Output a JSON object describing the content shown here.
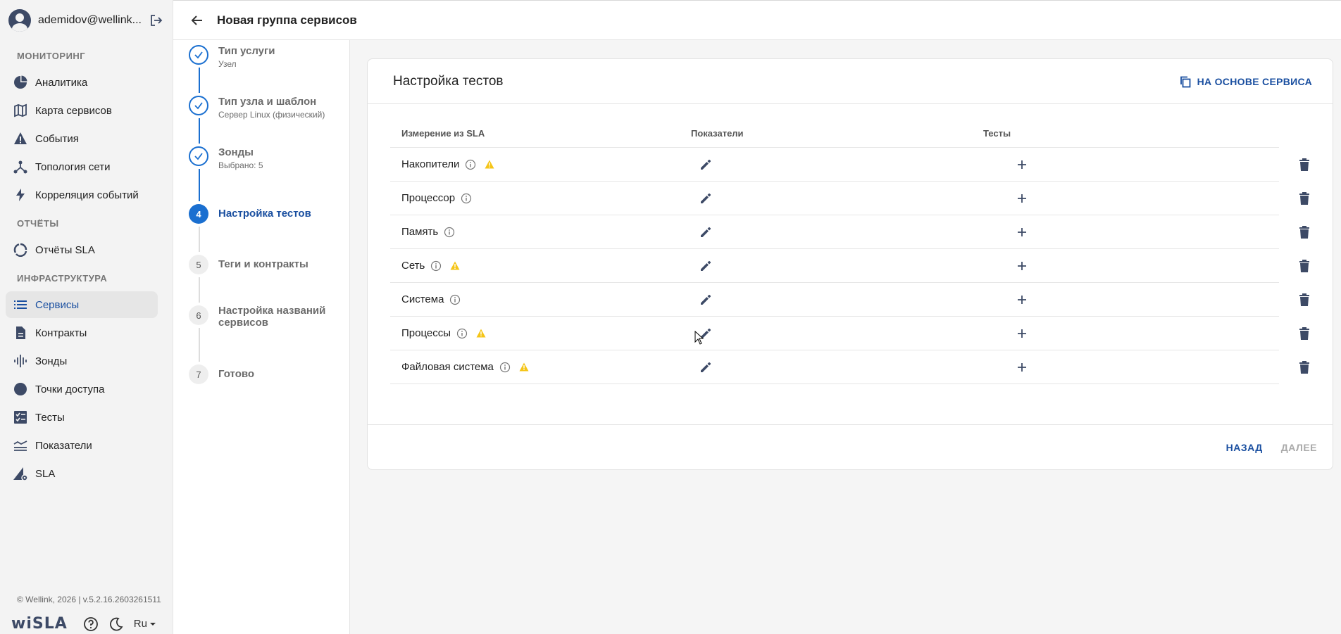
{
  "user": {
    "name": "ademidov@wellink..."
  },
  "sidebar": {
    "sections": [
      {
        "label": "МОНИТОРИНГ",
        "items": [
          {
            "label": "Аналитика",
            "icon": "pie-chart-icon"
          },
          {
            "label": "Карта сервисов",
            "icon": "map-icon"
          },
          {
            "label": "События",
            "icon": "warning-icon"
          },
          {
            "label": "Топология сети",
            "icon": "topology-icon"
          },
          {
            "label": "Корреляция событий",
            "icon": "lightning-icon"
          }
        ]
      },
      {
        "label": "ОТЧЁТЫ",
        "items": [
          {
            "label": "Отчёты SLA",
            "icon": "circle-arrows-icon"
          }
        ]
      },
      {
        "label": "ИНФРАСТРУКТУРА",
        "items": [
          {
            "label": "Сервисы",
            "icon": "list-icon",
            "active": true
          },
          {
            "label": "Контракты",
            "icon": "document-icon"
          },
          {
            "label": "Зонды",
            "icon": "probe-icon"
          },
          {
            "label": "Точки доступа",
            "icon": "dot-icon"
          },
          {
            "label": "Тесты",
            "icon": "checklist-icon"
          },
          {
            "label": "Показатели",
            "icon": "metrics-icon"
          },
          {
            "label": "SLA",
            "icon": "sla-icon"
          }
        ]
      }
    ],
    "footer": {
      "copyright": "© Wellink, 2026 | v.5.2.16.2603261511",
      "brand": "wiSLA",
      "lang": "Ru"
    }
  },
  "header": {
    "title": "Новая группа сервисов"
  },
  "steps": [
    {
      "num": "1",
      "title": "Тип услуги",
      "sub": "Узел",
      "state": "done"
    },
    {
      "num": "2",
      "title": "Тип узла и шаблон",
      "sub": "Сервер Linux (физический)",
      "state": "done"
    },
    {
      "num": "3",
      "title": "Зонды",
      "sub": "Выбрано: 5",
      "state": "done"
    },
    {
      "num": "4",
      "title": "Настройка тестов",
      "sub": "",
      "state": "current"
    },
    {
      "num": "5",
      "title": "Теги и контракты",
      "sub": "",
      "state": "todo"
    },
    {
      "num": "6",
      "title": "Настройка названий сервисов",
      "sub": "",
      "state": "todo"
    },
    {
      "num": "7",
      "title": "Готово",
      "sub": "",
      "state": "todo"
    }
  ],
  "card": {
    "title": "Настройка тестов",
    "based_on_label": "НА ОСНОВЕ СЕРВИСА",
    "columns": {
      "measure": "Измерение из SLA",
      "metrics": "Показатели",
      "tests": "Тесты"
    },
    "rows": [
      {
        "name": "Накопители",
        "warning": true
      },
      {
        "name": "Процессор",
        "warning": false
      },
      {
        "name": "Память",
        "warning": false
      },
      {
        "name": "Сеть",
        "warning": true
      },
      {
        "name": "Система",
        "warning": false
      },
      {
        "name": "Процессы",
        "warning": true
      },
      {
        "name": "Файловая система",
        "warning": true
      }
    ],
    "back_label": "НАЗАД",
    "next_label": "ДАЛЕЕ"
  },
  "colors": {
    "accent": "#1a4fa0",
    "step_active": "#1a6fd0",
    "warning": "#f5c518",
    "icon": "#3d4a66"
  }
}
